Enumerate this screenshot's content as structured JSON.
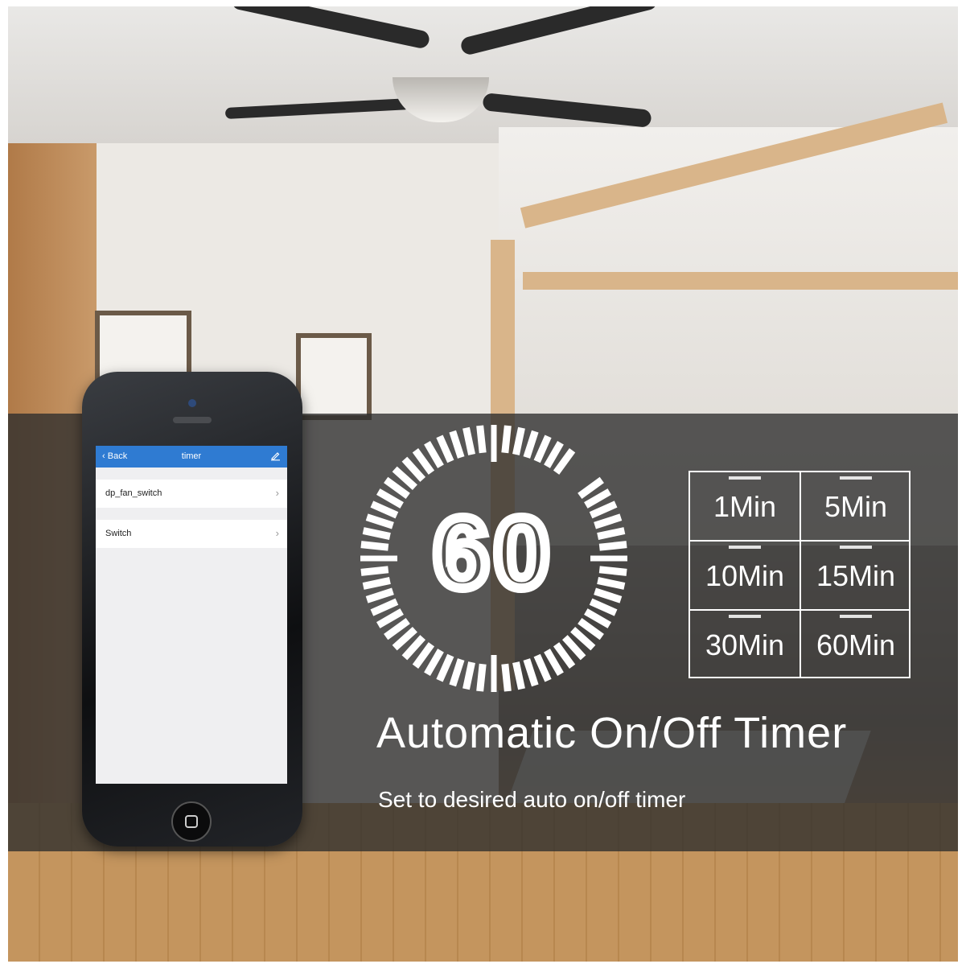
{
  "phone_app": {
    "back_label": "Back",
    "title": "timer",
    "rows": [
      {
        "label": "dp_fan_switch"
      },
      {
        "label": "Switch"
      }
    ]
  },
  "timer_display": {
    "value": "60"
  },
  "timer_options": [
    "1Min",
    "5Min",
    "10Min",
    "15Min",
    "30Min",
    "60Min"
  ],
  "headline": "Automatic On/Off Timer",
  "subheadline": "Set to desired auto on/off timer",
  "icons": [
    "chevron-left-icon",
    "edit-icon",
    "chevron-right-icon",
    "home-button-icon"
  ],
  "colors": {
    "app_header": "#2f7bd2",
    "overlay": "#2d2d2d",
    "text": "#ffffff"
  }
}
